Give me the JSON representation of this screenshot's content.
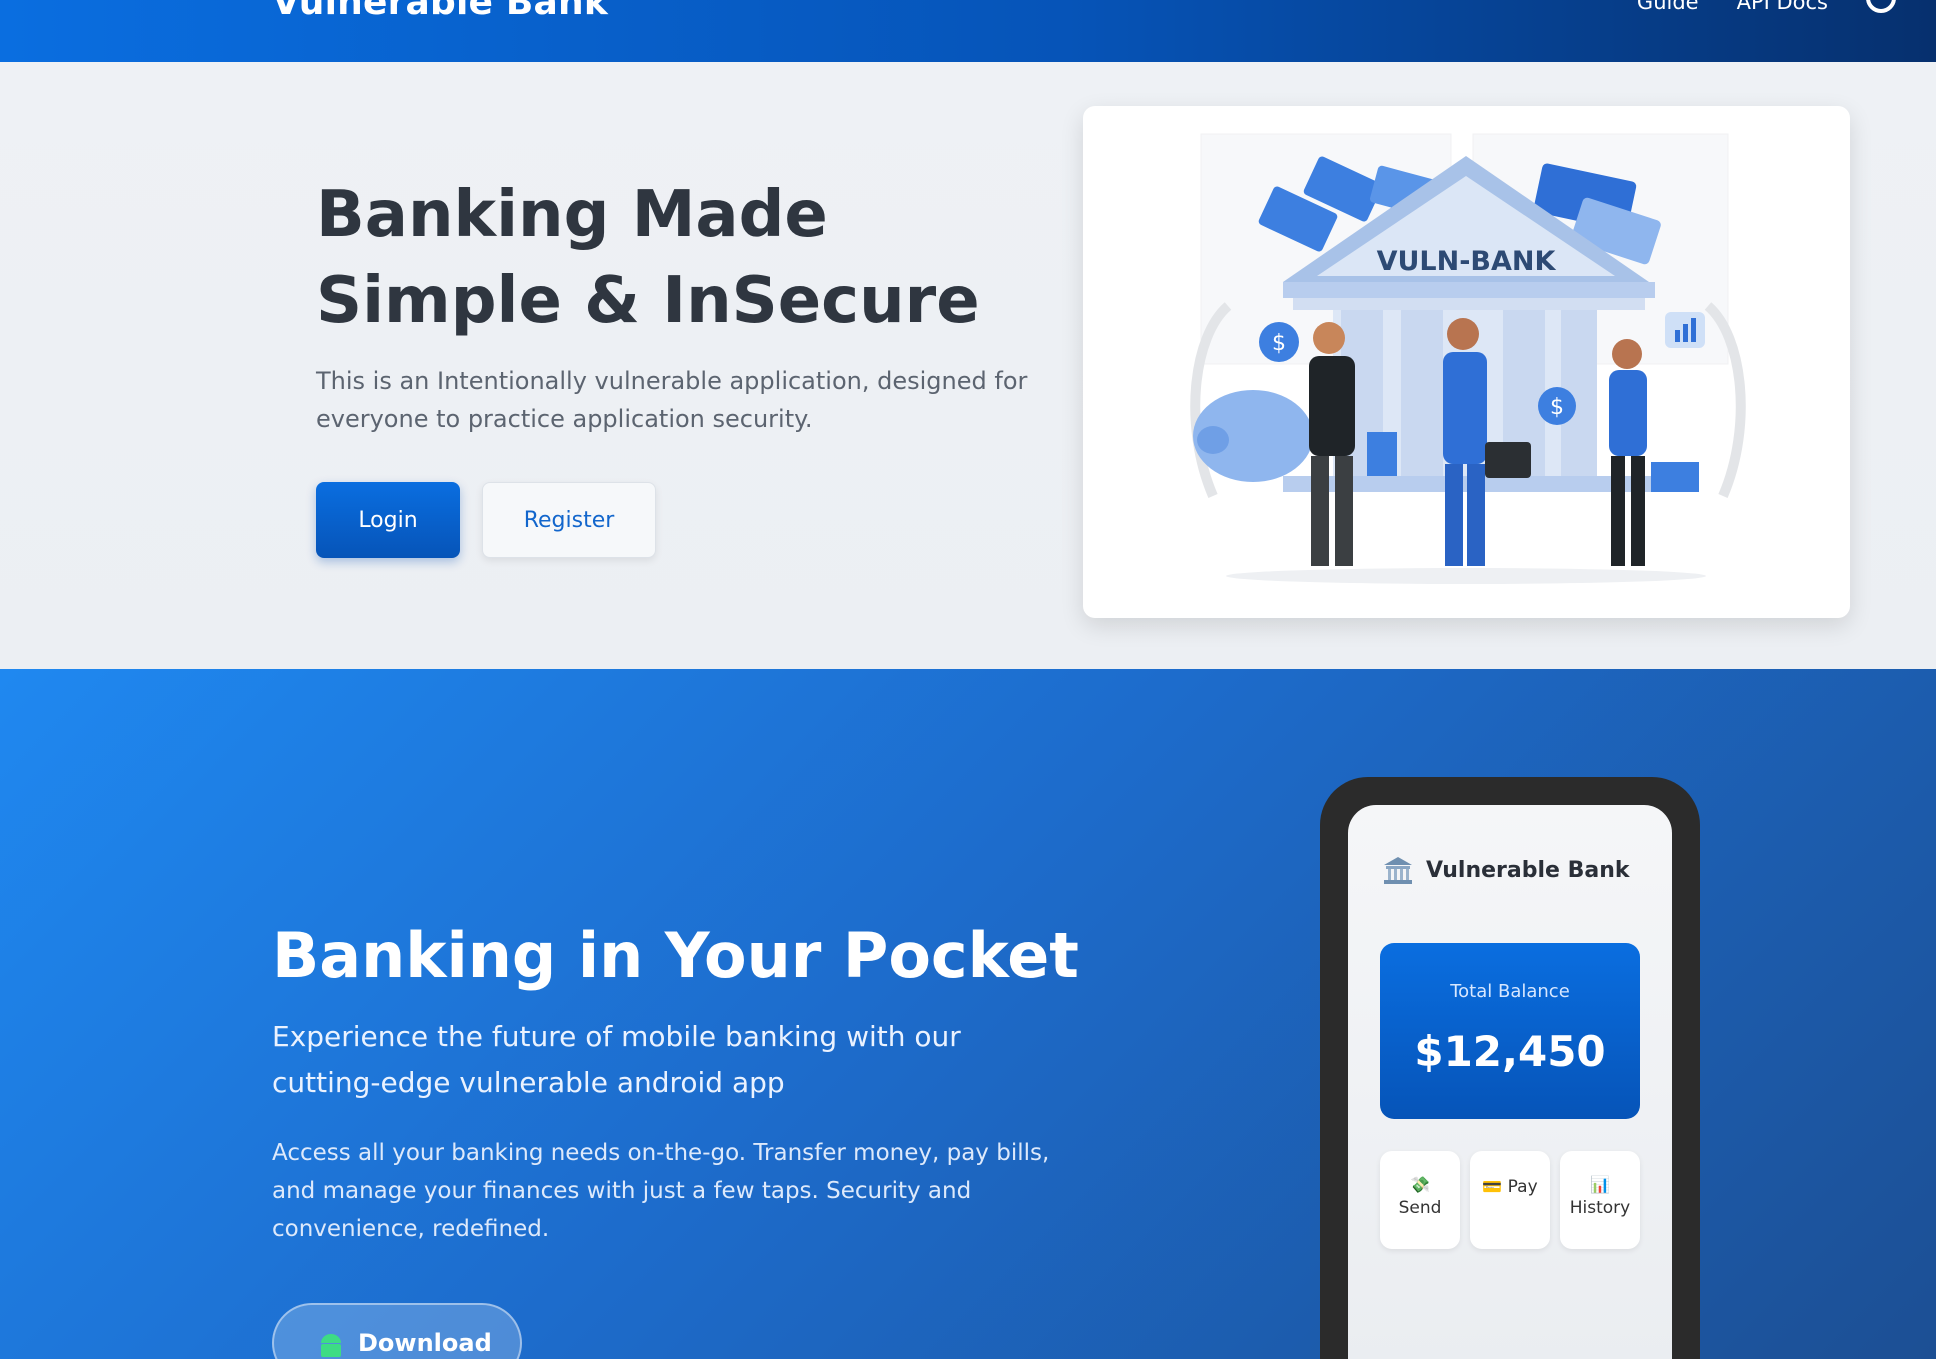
{
  "header": {
    "brand": "Vulnerable Bank",
    "nav": [
      "Guide",
      "API Docs"
    ]
  },
  "hero": {
    "title": "Banking Made Simple & InSecure",
    "subtitle": "This is an Intentionally vulnerable application, designed for everyone to practice application security.",
    "login_label": "Login",
    "register_label": "Register",
    "illustration_sign": "VULN-BANK"
  },
  "mobile": {
    "title": "Banking in Your Pocket",
    "subtitle": "Experience the future of mobile banking with our cutting-edge vulnerable android app",
    "description": "Access all your banking needs on-the-go. Transfer money, pay bills, and manage your finances with just a few taps. Security and convenience, redefined.",
    "download_label": "Download"
  },
  "phone": {
    "app_name": "Vulnerable Bank",
    "balance_label": "Total Balance",
    "balance_value": "$12,450",
    "actions": [
      {
        "label": "Send",
        "icon": "money-icon"
      },
      {
        "label": "Pay",
        "icon": "card-icon"
      },
      {
        "label": "History",
        "icon": "chart-icon"
      }
    ]
  },
  "colors": {
    "primary": "#0a6ee0",
    "dark_blue": "#06306e",
    "text_dark": "#2f3640"
  }
}
